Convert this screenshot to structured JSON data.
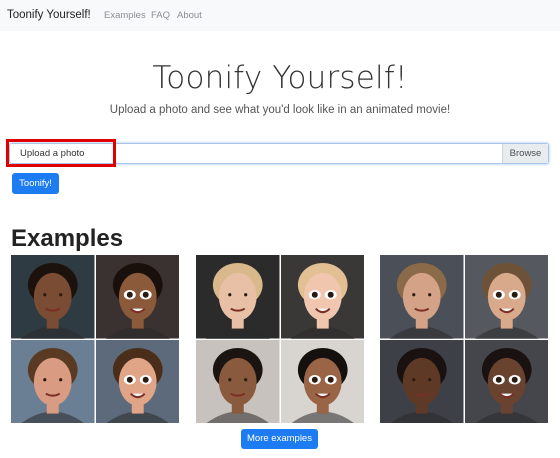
{
  "navbar": {
    "brand": "Toonify Yourself!",
    "links": [
      "Examples",
      "FAQ",
      "About"
    ]
  },
  "hero": {
    "title": "Toonify Yourself!",
    "subtitle": "Upload a photo and see what you'd look like in an animated movie!"
  },
  "upload": {
    "label": "Upload a photo",
    "browse": "Browse",
    "submit": "Toonify!"
  },
  "examples": {
    "title": "Examples",
    "more": "More examples",
    "items": [
      {
        "photos": [
          {
            "bg": "#2f3b42",
            "skin": "#7a4c33",
            "hair": "#1c120d",
            "cartoon": false
          },
          {
            "bg": "#3a3230",
            "skin": "#8b5a3a",
            "hair": "#1a100b",
            "cartoon": true
          },
          {
            "bg": "#6b7f94",
            "skin": "#d99c82",
            "hair": "#5a3a22",
            "cartoon": false
          },
          {
            "bg": "#5c6a7c",
            "skin": "#e0a487",
            "hair": "#4a2e1a",
            "cartoon": true
          }
        ]
      },
      {
        "photos": [
          {
            "bg": "#2b2b2b",
            "skin": "#e8c0a6",
            "hair": "#d9b98c",
            "cartoon": false
          },
          {
            "bg": "#3a3836",
            "skin": "#f0c7ae",
            "hair": "#e2c094",
            "cartoon": true
          },
          {
            "bg": "#c7c2bd",
            "skin": "#8a5a3f",
            "hair": "#1b1410",
            "cartoon": false
          },
          {
            "bg": "#d8d4d0",
            "skin": "#9a6446",
            "hair": "#15100d",
            "cartoon": true
          }
        ]
      },
      {
        "photos": [
          {
            "bg": "#4a4f58",
            "skin": "#d4a286",
            "hair": "#8a6a48",
            "cartoon": false
          },
          {
            "bg": "#55585e",
            "skin": "#d9a98c",
            "hair": "#6e5238",
            "cartoon": true
          },
          {
            "bg": "#3e4048",
            "skin": "#5e3a26",
            "hair": "#1a1210",
            "cartoon": false
          },
          {
            "bg": "#45464c",
            "skin": "#6a4330",
            "hair": "#1a1210",
            "cartoon": true
          }
        ]
      }
    ]
  }
}
